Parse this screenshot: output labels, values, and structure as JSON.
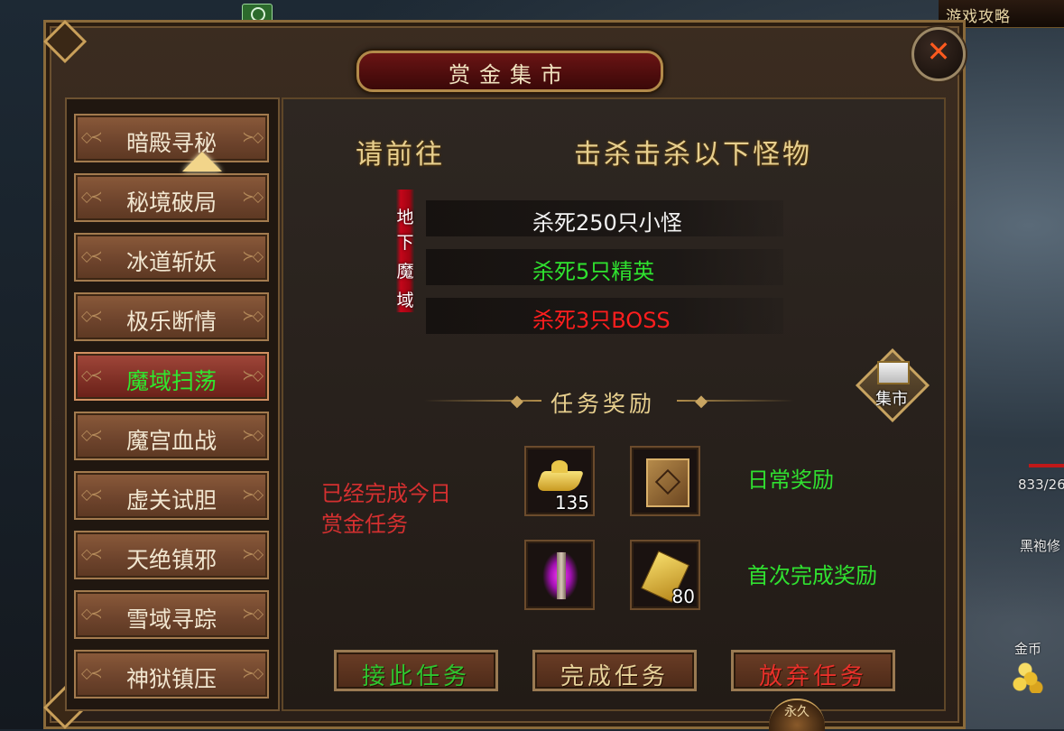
{
  "hud": {
    "top_right_title": "游戏攻略",
    "hp_text": "833/26",
    "npc_name": "黑袍修",
    "gold_label": "金币"
  },
  "window": {
    "title": "赏金集市",
    "close_label": "✕"
  },
  "sidebar": {
    "items": [
      {
        "label": "暗殿寻秘"
      },
      {
        "label": "秘境破局"
      },
      {
        "label": "冰道斩妖"
      },
      {
        "label": "极乐断情"
      },
      {
        "label": "魔域扫荡"
      },
      {
        "label": "魔宫血战"
      },
      {
        "label": "虚关试胆"
      },
      {
        "label": "天绝镇邪"
      },
      {
        "label": "雪域寻踪"
      },
      {
        "label": "神狱镇压"
      }
    ],
    "active_item": "魔域扫荡"
  },
  "content": {
    "goto_heading": "请前往",
    "objective_heading": "击杀击杀以下怪物",
    "location_tag": [
      "地",
      "下",
      "魔",
      "域"
    ],
    "tasks": [
      {
        "label": "杀死250只小怪",
        "color": "#f2f2f2"
      },
      {
        "label": "杀死5只精英",
        "color": "#2fe22f"
      },
      {
        "label": "杀死3只BOSS",
        "color": "#ff1e1e"
      }
    ],
    "reward_title": "任务奖励",
    "market_button": "集市",
    "status_line1": "已经完成今日",
    "status_line2": "赏金任务",
    "daily_reward_label": "日常奖励",
    "first_reward_label": "首次完成奖励",
    "daily_rewards": [
      {
        "icon": "gold-ingot-icon",
        "count": "135"
      },
      {
        "icon": "treasure-chest-icon",
        "count": ""
      }
    ],
    "first_rewards": [
      {
        "icon": "purple-pillar-icon",
        "count": ""
      },
      {
        "icon": "scroll-ticket-icon",
        "count": "80"
      }
    ]
  },
  "actions": {
    "accept": "接此任务",
    "complete": "完成任务",
    "abandon": "放弃任务",
    "accept_color": "#2fc42f",
    "complete_color": "#e7d29a",
    "abandon_color": "#e8302a"
  },
  "bottom_badge": "永久"
}
